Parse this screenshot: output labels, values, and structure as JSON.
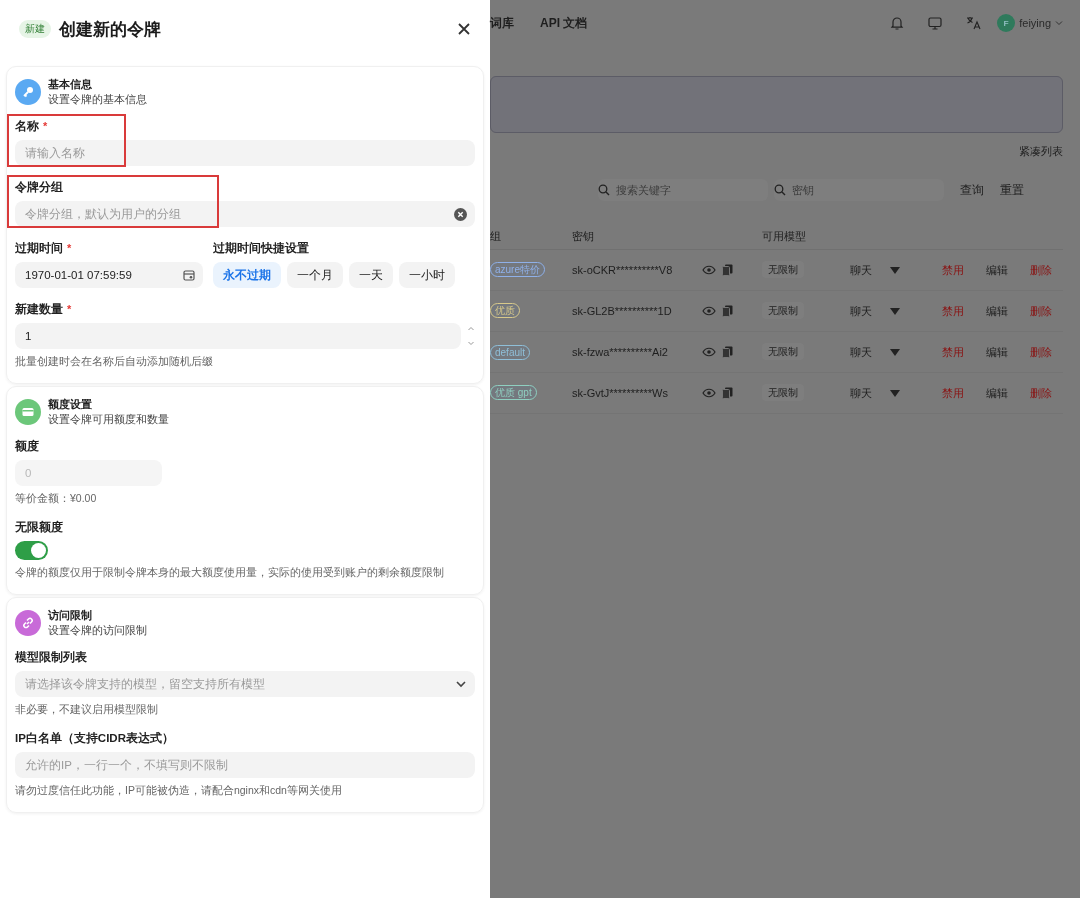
{
  "drawer": {
    "badge": "新建",
    "title": "创建新的令牌",
    "sections": [
      {
        "color": "#5aa9f2",
        "title": "基本信息",
        "subtitle": "设置令牌的基本信息",
        "fields": [
          {
            "kind": "text",
            "label": "名称",
            "required_mark": "*",
            "placeholder": "请输入名称",
            "highlighted": true
          },
          {
            "kind": "text",
            "label": "令牌分组",
            "placeholder": "令牌分组，默认为用户的分组",
            "highlighted": true,
            "clearable": true
          },
          {
            "kind": "expiry",
            "label": "过期时间",
            "required_mark": "*",
            "value": "1970-01-01 07:59:59",
            "quick_label": "过期时间快捷设置",
            "options": [
              {
                "label": "永不过期",
                "selected": true
              },
              {
                "label": "一个月",
                "selected": false
              },
              {
                "label": "一天",
                "selected": false
              },
              {
                "label": "一小时",
                "selected": false
              }
            ]
          },
          {
            "kind": "number",
            "label": "新建数量",
            "required_mark": "*",
            "value": "1",
            "hint": "批量创建时会在名称后自动添加随机后缀"
          }
        ]
      },
      {
        "color": "#6cc77a",
        "title": "额度设置",
        "subtitle": "设置令牌可用额度和数量",
        "fields": [
          {
            "kind": "text",
            "label": "额度",
            "placeholder": "0",
            "disabled": true,
            "hint": "等价金额：¥0.00"
          },
          {
            "kind": "toggle",
            "label": "无限额度",
            "on": true,
            "hint": "令牌的额度仅用于限制令牌本身的最大额度使用量，实际的使用受到账户的剩余额度限制"
          }
        ]
      },
      {
        "color": "#c86ad8",
        "title": "访问限制",
        "subtitle": "设置令牌的访问限制",
        "fields": [
          {
            "kind": "select",
            "label": "模型限制列表",
            "placeholder": "请选择该令牌支持的模型，留空支持所有模型",
            "hint": "非必要，不建议启用模型限制"
          },
          {
            "kind": "text",
            "label": "IP白名单（支持CIDR表达式）",
            "placeholder": "允许的IP，一行一个，不填写则不限制",
            "hint": "请勿过度信任此功能，IP可能被伪造，请配合nginx和cdn等网关使用"
          }
        ]
      }
    ]
  },
  "background_page": {
    "nav": [
      "词库",
      "API 文档"
    ],
    "user": {
      "initial": "F",
      "name": "feiying"
    },
    "compact_label": "紧凑列表",
    "search": [
      {
        "placeholder": "搜索关键字"
      },
      {
        "placeholder": "密钥"
      }
    ],
    "buttons": [
      "查询",
      "重置"
    ],
    "table": {
      "columns": [
        "组",
        "密钥",
        "可用模型"
      ],
      "rows": [
        {
          "group": "azure特价",
          "color": "#8fb0e8",
          "key": "sk-oCKR**********V8",
          "models": "无限制",
          "type": "聊天",
          "actions": [
            {
              "label": "禁用",
              "kind": "danger"
            },
            {
              "label": "编辑",
              "kind": "normal"
            },
            {
              "label": "删除",
              "kind": "danger"
            }
          ]
        },
        {
          "group": "优质",
          "color": "#d8c98a",
          "key": "sk-GL2B**********1D",
          "models": "无限制",
          "type": "聊天",
          "actions": [
            {
              "label": "禁用",
              "kind": "danger"
            },
            {
              "label": "编辑",
              "kind": "normal"
            },
            {
              "label": "删除",
              "kind": "danger"
            }
          ]
        },
        {
          "group": "default",
          "color": "#8fbfd8",
          "key": "sk-fzwa**********Ai2",
          "models": "无限制",
          "type": "聊天",
          "actions": [
            {
              "label": "禁用",
              "kind": "danger"
            },
            {
              "label": "编辑",
              "kind": "normal"
            },
            {
              "label": "删除",
              "kind": "danger"
            }
          ]
        },
        {
          "group": "优质 gpt",
          "color": "#8fcfc0",
          "key": "sk-GvtJ**********Ws",
          "models": "无限制",
          "type": "聊天",
          "actions": [
            {
              "label": "禁用",
              "kind": "danger"
            },
            {
              "label": "编辑",
              "kind": "normal"
            },
            {
              "label": "删除",
              "kind": "danger"
            }
          ]
        }
      ]
    }
  }
}
